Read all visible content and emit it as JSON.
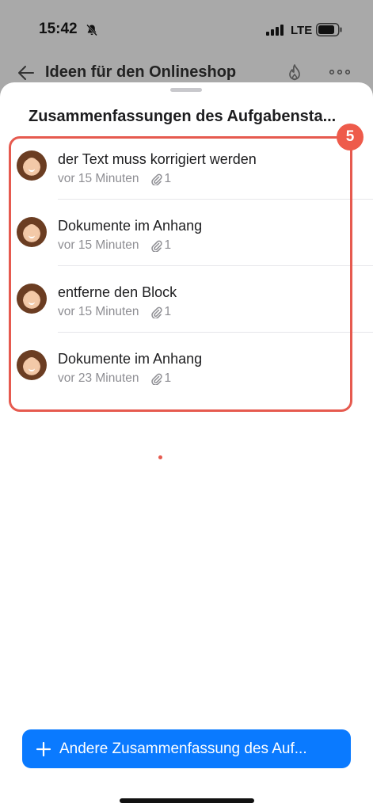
{
  "status_bar": {
    "time": "15:42",
    "network": "LTE",
    "icons": [
      "bell-slash-icon",
      "signal-icon",
      "battery-icon"
    ]
  },
  "background_header": {
    "title": "Ideen für den Onlineshop",
    "icons": [
      "back-arrow-icon",
      "flame-icon",
      "more-icon"
    ]
  },
  "sheet": {
    "title": "Zusammenfassungen des Aufgabensta...",
    "badge": "5",
    "items": [
      {
        "title": "der Text muss korrigiert werden",
        "time": "vor 15 Minuten",
        "attachments": "1"
      },
      {
        "title": "Dokumente im Anhang",
        "time": "vor 15 Minuten",
        "attachments": "1"
      },
      {
        "title": "entferne den Block",
        "time": "vor 15 Minuten",
        "attachments": "1"
      },
      {
        "title": "Dokumente im Anhang",
        "time": "vor 23 Minuten",
        "attachments": "1"
      }
    ],
    "button_label": "Andere Zusammenfassung des Auf..."
  },
  "colors": {
    "accent": "#0a7aff",
    "highlight": "#e65a4f",
    "badge": "#ee5b4b",
    "dim_background": "#a9a9a9"
  }
}
